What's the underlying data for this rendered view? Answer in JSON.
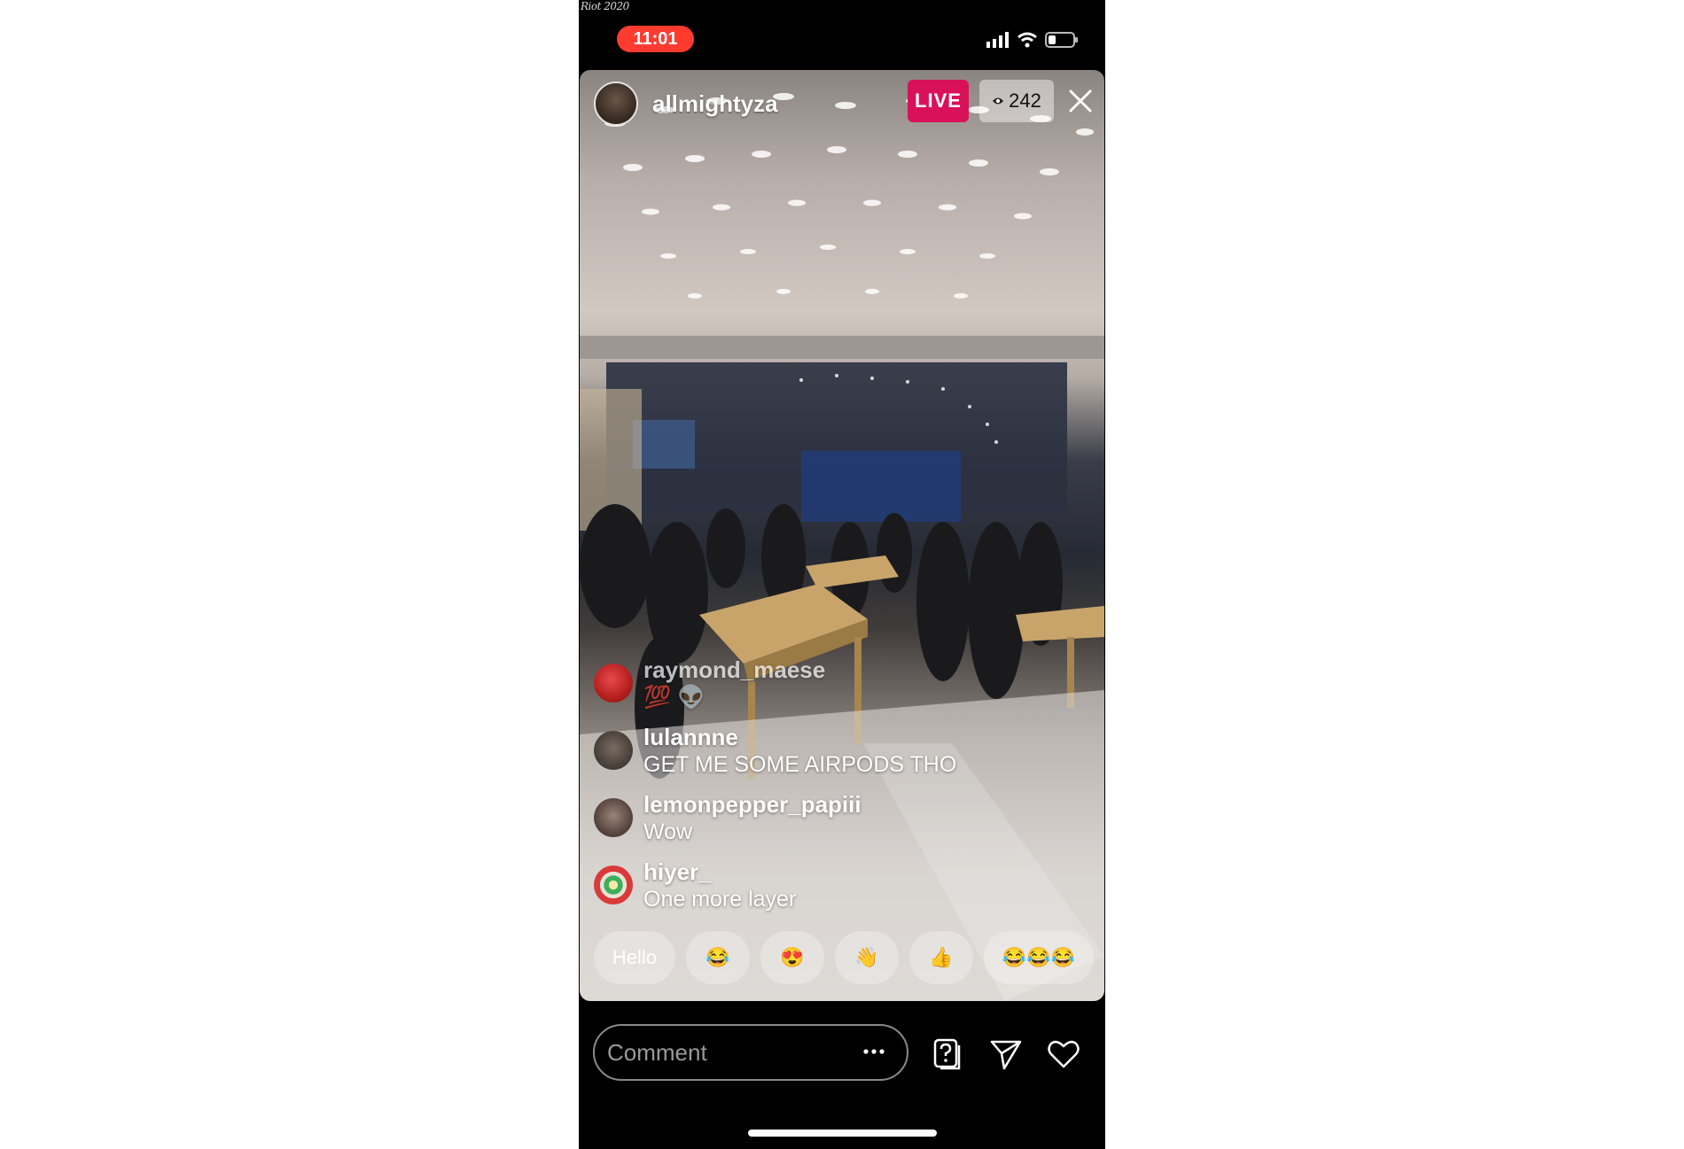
{
  "watermark": "Riot 2020",
  "status_bar": {
    "time": "11:01"
  },
  "live": {
    "host_username": "allmightyza",
    "live_label": "LIVE",
    "viewer_count": "242"
  },
  "comments": [
    {
      "username": "raymond_maese",
      "text": "💯 👽"
    },
    {
      "username": "lulannne",
      "text": "GET ME SOME AIRPODS THO"
    },
    {
      "username": "lemonpepper_papiii",
      "text": "Wow"
    },
    {
      "username": "hiyer_",
      "text": "One more layer"
    }
  ],
  "quick_reactions": [
    "Hello",
    "😂",
    "😍",
    "👋",
    "👍",
    "😂😂😂"
  ],
  "comment_box": {
    "placeholder": "Comment"
  },
  "colors": {
    "live_badge": "#d9115a",
    "time_pill": "#ff3b30"
  },
  "icons": [
    "eye-icon",
    "close-icon",
    "more-icon",
    "question-icon",
    "send-icon",
    "heart-icon"
  ]
}
